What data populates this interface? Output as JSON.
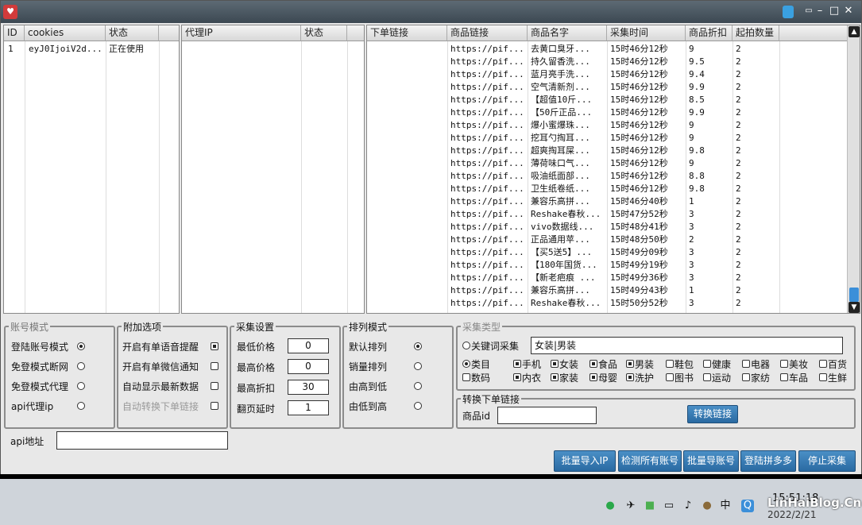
{
  "app": {
    "icon": "heart-icon"
  },
  "titlebar": {
    "buttons": [
      "tshirt-icon",
      "restore-icon",
      "minimize-icon",
      "maximize-icon",
      "close-icon"
    ]
  },
  "accounts": {
    "headers": [
      "ID",
      "cookies",
      "状态"
    ],
    "rows": [
      [
        "1",
        "eyJ0IjoiV2d...",
        "正在使用"
      ]
    ]
  },
  "proxies": {
    "headers": [
      "代理IP",
      "状态"
    ]
  },
  "items": {
    "headers": [
      "下单链接",
      "商品链接",
      "商品名字",
      "采集时间",
      "商品折扣",
      "起拍数量"
    ],
    "rows": [
      [
        "",
        "https://pif...",
        "去黄口臭牙...",
        "15时46分12秒",
        "9",
        "2"
      ],
      [
        "",
        "https://pif...",
        "持久留香洗...",
        "15时46分12秒",
        "9.5",
        "2"
      ],
      [
        "",
        "https://pif...",
        "蓝月亮手洗...",
        "15时46分12秒",
        "9.4",
        "2"
      ],
      [
        "",
        "https://pif...",
        "空气清新剂...",
        "15时46分12秒",
        "9.9",
        "2"
      ],
      [
        "",
        "https://pif...",
        "【超值10斤...",
        "15时46分12秒",
        "8.5",
        "2"
      ],
      [
        "",
        "https://pif...",
        "【50斤正品...",
        "15时46分12秒",
        "9.9",
        "2"
      ],
      [
        "",
        "https://pif...",
        "爆小蜜爆珠...",
        "15时46分12秒",
        "9",
        "2"
      ],
      [
        "",
        "https://pif...",
        "挖耳勺掏耳...",
        "15时46分12秒",
        "9",
        "2"
      ],
      [
        "",
        "https://pif...",
        "超爽掏耳屎...",
        "15时46分12秒",
        "9.8",
        "2"
      ],
      [
        "",
        "https://pif...",
        "薄荷味口气...",
        "15时46分12秒",
        "9",
        "2"
      ],
      [
        "",
        "https://pif...",
        "吸油纸面部...",
        "15时46分12秒",
        "8.8",
        "2"
      ],
      [
        "",
        "https://pif...",
        "卫生纸卷纸...",
        "15时46分12秒",
        "9.8",
        "2"
      ],
      [
        "",
        "https://pif...",
        "兼容乐高拼...",
        "15时46分40秒",
        "1",
        "2"
      ],
      [
        "",
        "https://pif...",
        "Reshake春秋...",
        "15时47分52秒",
        "3",
        "2"
      ],
      [
        "",
        "https://pif...",
        "vivo数据线...",
        "15时48分41秒",
        "3",
        "2"
      ],
      [
        "",
        "https://pif...",
        "正品通用苹...",
        "15时48分50秒",
        "2",
        "2"
      ],
      [
        "",
        "https://pif...",
        "【买5送5】...",
        "15时49分09秒",
        "3",
        "2"
      ],
      [
        "",
        "https://pif...",
        "【180年国货...",
        "15时49分19秒",
        "3",
        "2"
      ],
      [
        "",
        "https://pif...",
        "【新老疤痕 ...",
        "15时49分36秒",
        "3",
        "2"
      ],
      [
        "",
        "https://pif...",
        "兼容乐高拼...",
        "15时49分43秒",
        "1",
        "2"
      ],
      [
        "",
        "https://pif...",
        "Reshake春秋...",
        "15时50分52秒",
        "3",
        "2"
      ]
    ]
  },
  "account_mode": {
    "title": "账号模式",
    "options": [
      {
        "label": "登陆账号模式",
        "selected": true
      },
      {
        "label": "免登模式断网",
        "selected": false
      },
      {
        "label": "免登模式代理",
        "selected": false
      },
      {
        "label": "api代理ip",
        "selected": false
      }
    ]
  },
  "extra": {
    "title": "附加选项",
    "options": [
      {
        "label": "开启有单语音提醒",
        "checked": true
      },
      {
        "label": "开启有单微信通知",
        "checked": false
      },
      {
        "label": "自动显示最新数据",
        "checked": false
      },
      {
        "label": "自动转换下单链接",
        "checked": false,
        "disabled": true
      }
    ]
  },
  "collect": {
    "title": "采集设置",
    "fields": [
      {
        "label": "最低价格",
        "value": "0"
      },
      {
        "label": "最高价格",
        "value": "0"
      },
      {
        "label": "最高折扣",
        "value": "30"
      },
      {
        "label": "翻页延时",
        "value": "1"
      }
    ]
  },
  "sort": {
    "title": "排列模式",
    "options": [
      {
        "label": "默认排列",
        "selected": true
      },
      {
        "label": "销量排列",
        "selected": false
      },
      {
        "label": "由高到低",
        "selected": false
      },
      {
        "label": "由低到高",
        "selected": false
      }
    ]
  },
  "category": {
    "title": "采集类型",
    "keyword_label": "关键词采集",
    "keyword_value": "女装|男装",
    "type_label": "类目",
    "items": [
      {
        "label": "手机",
        "checked": true
      },
      {
        "label": "女装",
        "checked": true
      },
      {
        "label": "食品",
        "checked": true
      },
      {
        "label": "男装",
        "checked": true
      },
      {
        "label": "鞋包",
        "checked": false
      },
      {
        "label": "健康",
        "checked": false
      },
      {
        "label": "电器",
        "checked": false
      },
      {
        "label": "美妆",
        "checked": false
      },
      {
        "label": "百货",
        "checked": false
      },
      {
        "label": "数码",
        "checked": false
      },
      {
        "label": "内衣",
        "checked": true
      },
      {
        "label": "家装",
        "checked": true
      },
      {
        "label": "母婴",
        "checked": true
      },
      {
        "label": "洗护",
        "checked": true
      },
      {
        "label": "图书",
        "checked": false
      },
      {
        "label": "运动",
        "checked": false
      },
      {
        "label": "家纺",
        "checked": false
      },
      {
        "label": "车品",
        "checked": false
      },
      {
        "label": "生鲜",
        "checked": false
      }
    ]
  },
  "convert": {
    "title": "转换下单链接",
    "label": "商品id",
    "value": "",
    "button": "转换链接"
  },
  "api": {
    "label": "api地址",
    "value": ""
  },
  "actions": [
    "批量导入IP",
    "检测所有账号",
    "批量导账号",
    "登陆拼多多",
    "停止采集"
  ],
  "taskbar": {
    "lang": "中",
    "time": "15:51:18",
    "date": "2022/2/21",
    "watermark": "LinHaiBlog.Cn"
  }
}
